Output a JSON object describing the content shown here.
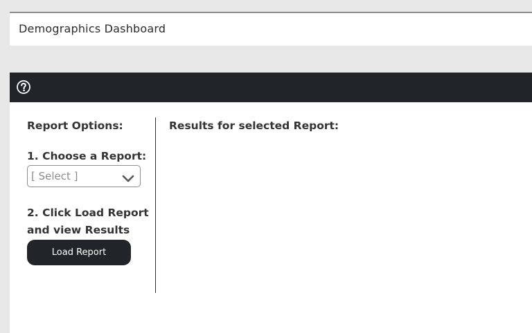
{
  "header": {
    "title": "Demographics Dashboard"
  },
  "toolbar": {
    "help_icon": "question-circle-icon"
  },
  "options": {
    "title": "Report Options:",
    "step1_label": "1. Choose a Report:",
    "select_value": "[ Select ]",
    "step2_line1": "2. Click Load Report",
    "step2_line2": "and view Results",
    "load_button": "Load Report"
  },
  "results": {
    "title": "Results for selected Report:"
  },
  "colors": {
    "background": "#e8e8e8",
    "dark_bar": "#212428",
    "button": "#212428",
    "panel": "#ffffff"
  }
}
